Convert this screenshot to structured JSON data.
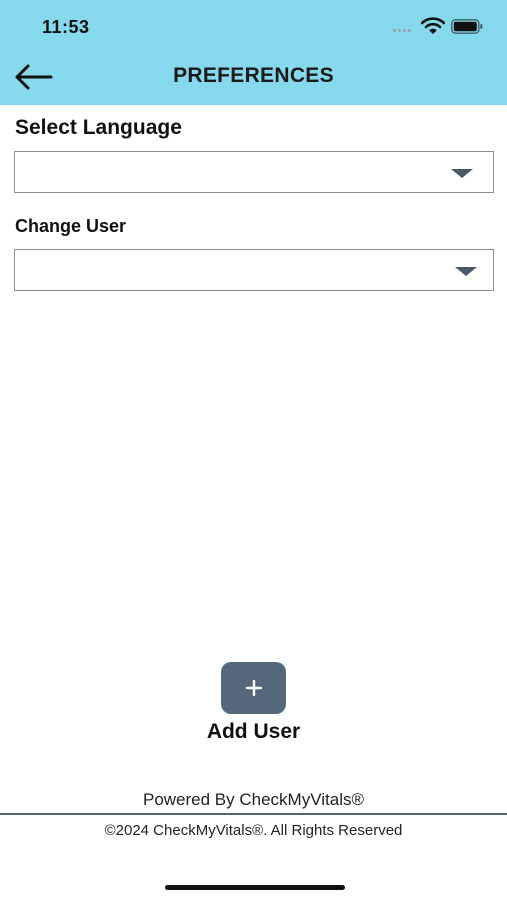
{
  "status_bar": {
    "time": "11:53",
    "icons": [
      "signal-dots-icon",
      "wifi-icon",
      "battery-icon"
    ]
  },
  "header": {
    "title": "PREFERENCES",
    "back_icon": "arrow-left-icon",
    "background_color": "#86d8ec"
  },
  "language": {
    "label": "Select Language",
    "value": ""
  },
  "user": {
    "label": "Change User",
    "value": ""
  },
  "add_user": {
    "icon": "plus-icon",
    "label": "Add User",
    "button_color": "#54687a"
  },
  "footer": {
    "powered_by": "Powered By CheckMyVitals®",
    "copyright": "©2024 CheckMyVitals®. All Rights Reserved"
  }
}
